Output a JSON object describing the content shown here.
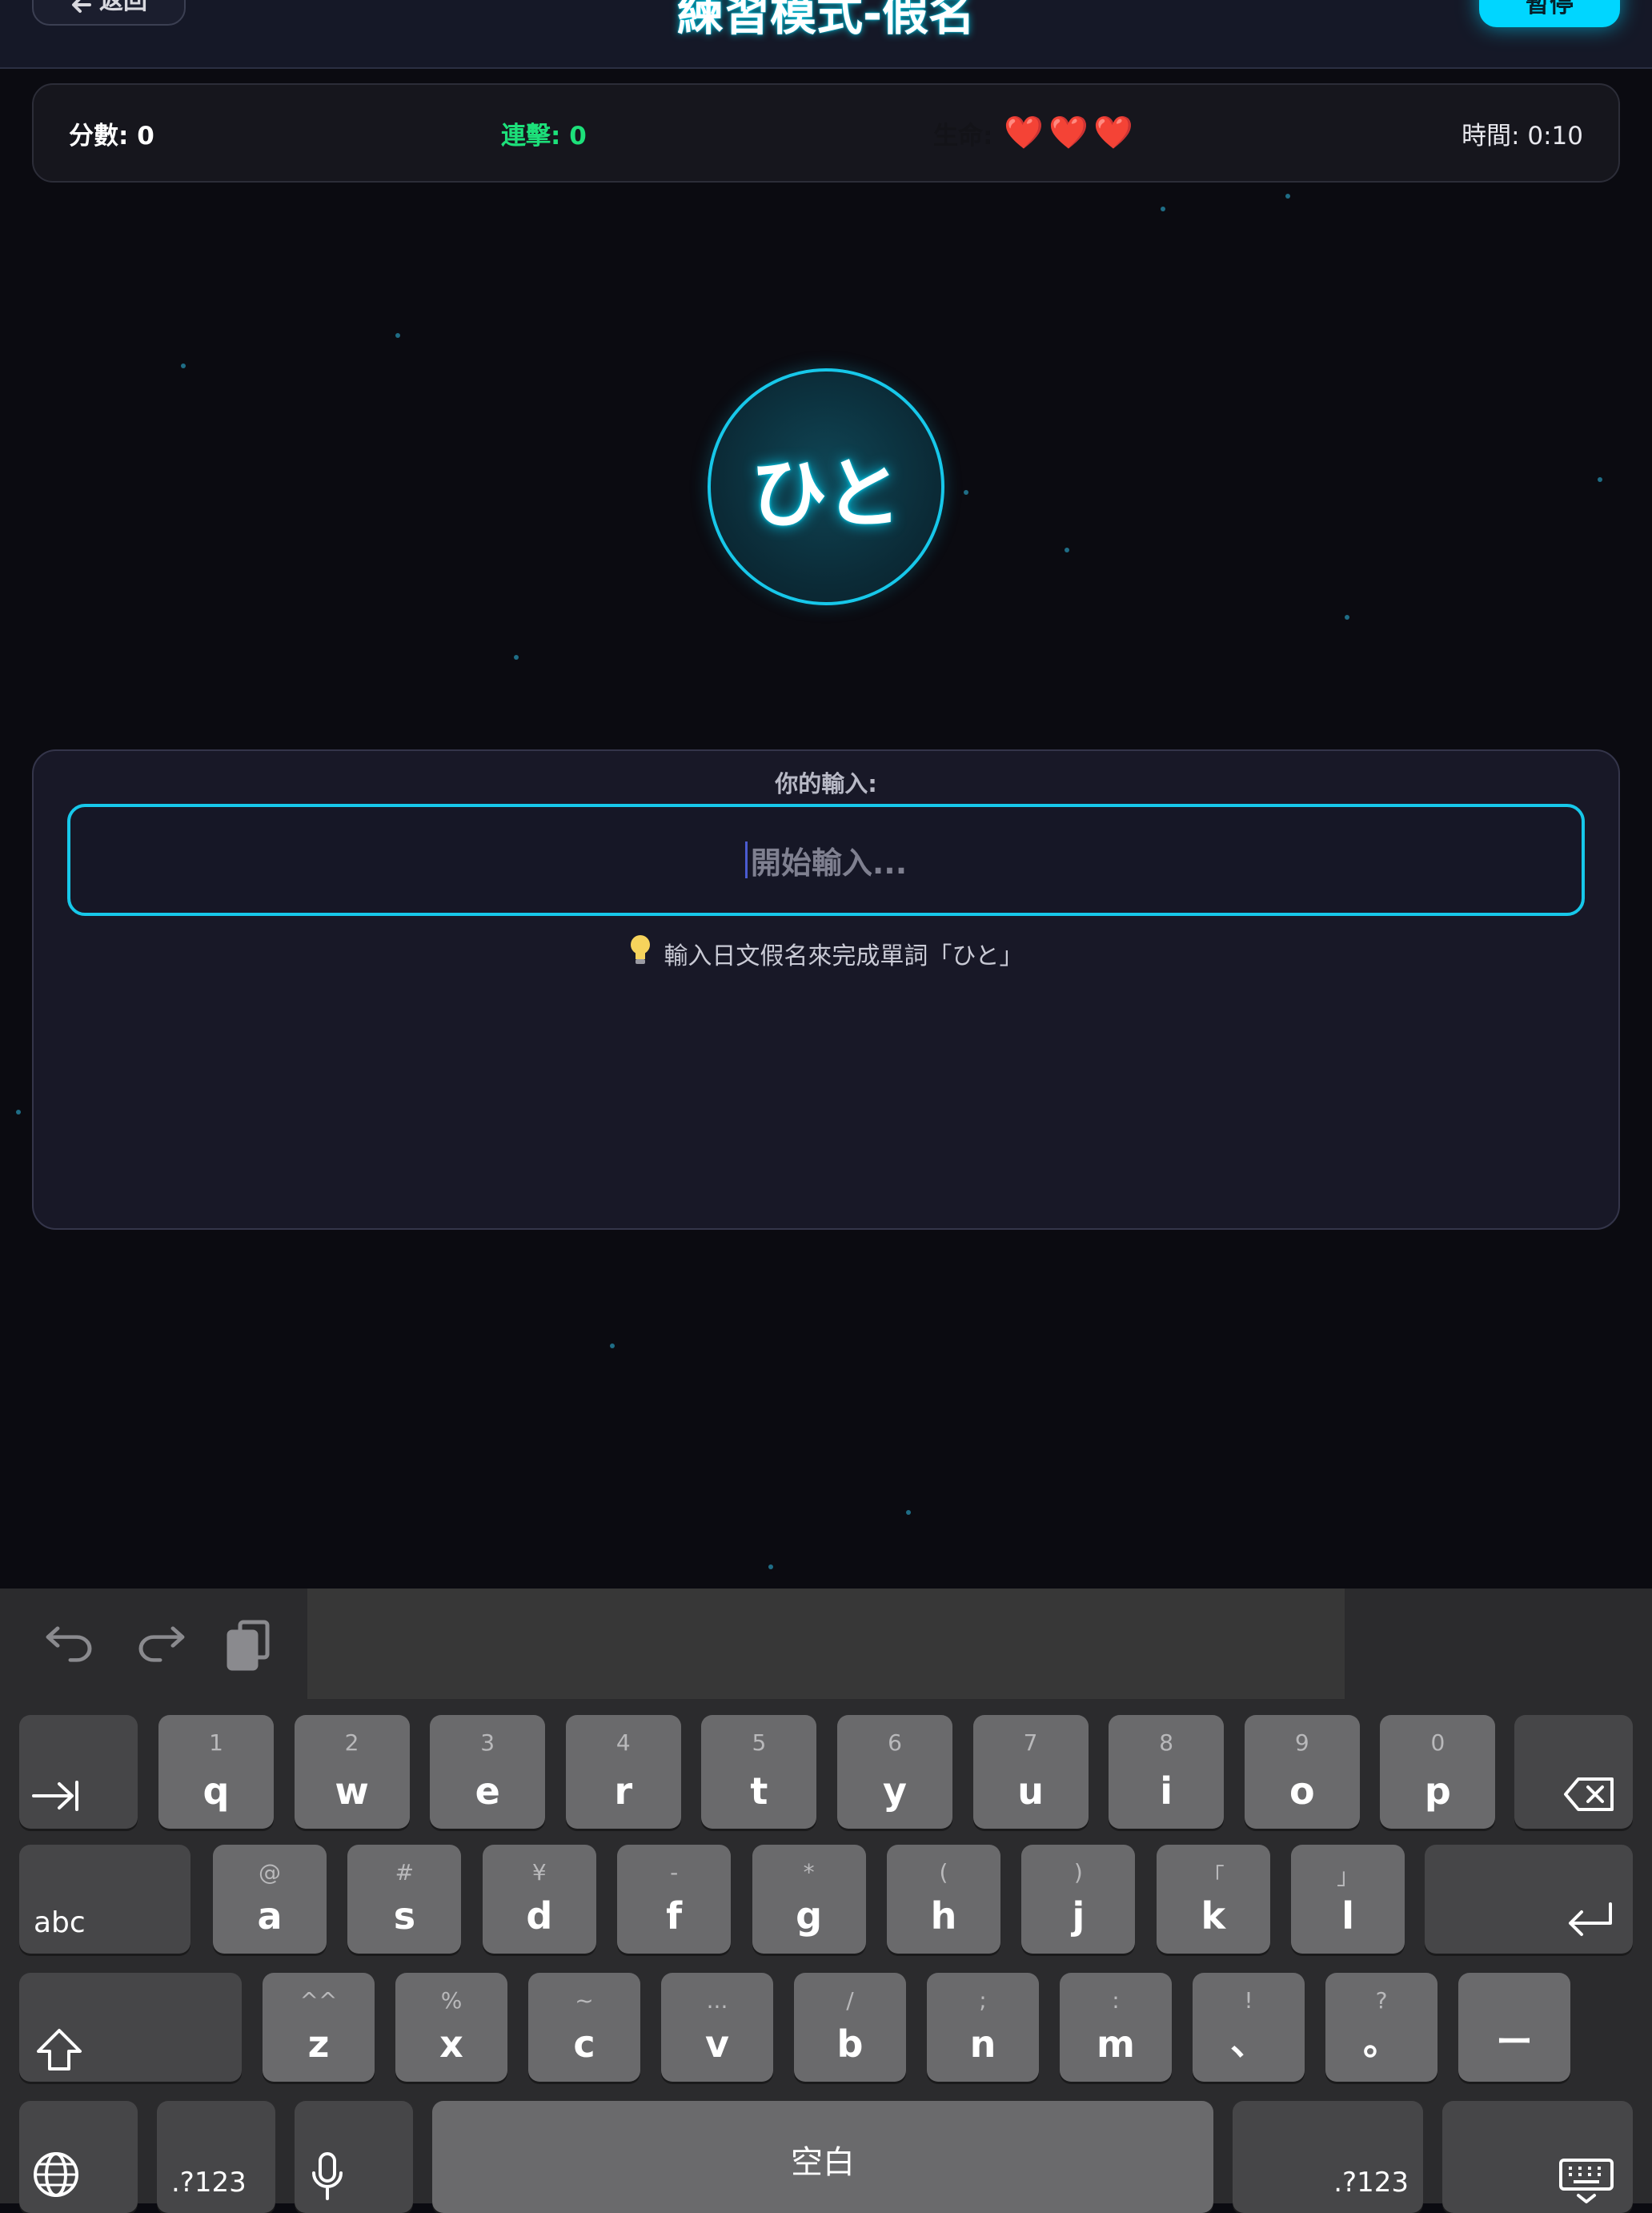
{
  "header": {
    "back_label": "返回",
    "title": "練習模式-假名",
    "pause_label": "暫停"
  },
  "status": {
    "score": "分數: 0",
    "combo": "連擊: 0",
    "lives_label": "生命:",
    "hearts": [
      "❤️",
      "❤️",
      "❤️"
    ],
    "time": "時間: 0:10"
  },
  "word": "ひと",
  "panel": {
    "label": "你的輸入:",
    "placeholder": "開始輸入...",
    "hint": "輸入日文假名來完成單詞「ひと」"
  },
  "keyboard": {
    "row1": [
      {
        "main": "q",
        "sub": "1"
      },
      {
        "main": "w",
        "sub": "2"
      },
      {
        "main": "e",
        "sub": "3"
      },
      {
        "main": "r",
        "sub": "4"
      },
      {
        "main": "t",
        "sub": "5"
      },
      {
        "main": "y",
        "sub": "6"
      },
      {
        "main": "u",
        "sub": "7"
      },
      {
        "main": "i",
        "sub": "8"
      },
      {
        "main": "o",
        "sub": "9"
      },
      {
        "main": "p",
        "sub": "0"
      }
    ],
    "row2": [
      {
        "main": "a",
        "sub": "@"
      },
      {
        "main": "s",
        "sub": "#"
      },
      {
        "main": "d",
        "sub": "¥"
      },
      {
        "main": "f",
        "sub": "-"
      },
      {
        "main": "g",
        "sub": "*"
      },
      {
        "main": "h",
        "sub": "("
      },
      {
        "main": "j",
        "sub": ")"
      },
      {
        "main": "k",
        "sub": "「"
      },
      {
        "main": "l",
        "sub": "」"
      }
    ],
    "row3": [
      {
        "main": "z",
        "sub": "^^"
      },
      {
        "main": "x",
        "sub": "%"
      },
      {
        "main": "c",
        "sub": "~"
      },
      {
        "main": "v",
        "sub": "..."
      },
      {
        "main": "b",
        "sub": "/"
      },
      {
        "main": "n",
        "sub": ";"
      },
      {
        "main": "m",
        "sub": ":"
      },
      {
        "main": "、",
        "sub": "!"
      },
      {
        "main": "。",
        "sub": "?"
      },
      {
        "main": "ー",
        "sub": ""
      }
    ],
    "abc_label": "abc",
    "num_label": ".?123",
    "space_label": "空白"
  },
  "colors": {
    "accent": "#17c8ea",
    "combo": "#1de07a",
    "background": "#0b0b11"
  }
}
